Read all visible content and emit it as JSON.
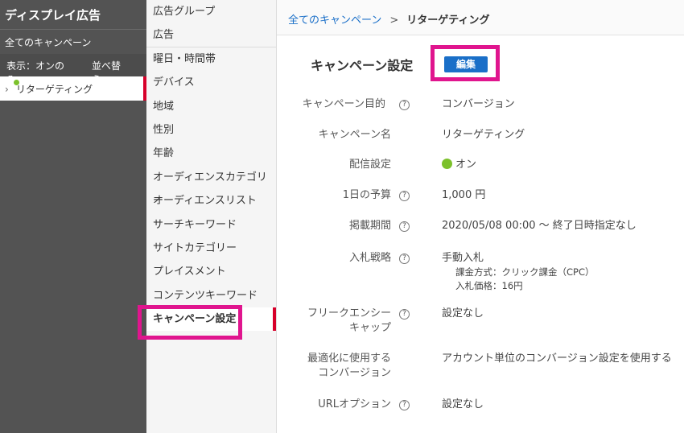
{
  "sidebar": {
    "title": "ディスプレイ広告",
    "all_campaigns": "全てのキャンペーン",
    "filter_label": "表示：オンのみ",
    "sort_label": "並べ替え",
    "campaign_name": "リターゲティング",
    "status_color": "#7cc12b"
  },
  "midnav": {
    "items": [
      {
        "label": "広告グループ"
      },
      {
        "label": "広告"
      },
      {
        "label": "曜日・時間帯"
      },
      {
        "label": "デバイス"
      },
      {
        "label": "地域"
      },
      {
        "label": "性別"
      },
      {
        "label": "年齢"
      },
      {
        "label": "オーディエンスカテゴリー"
      },
      {
        "label": "オーディエンスリスト"
      },
      {
        "label": "サーチキーワード"
      },
      {
        "label": "サイトカテゴリー"
      },
      {
        "label": "プレイスメント"
      },
      {
        "label": "コンテンツキーワード"
      },
      {
        "label": "キャンペーン設定"
      }
    ],
    "active_index": 13
  },
  "breadcrumb": {
    "root": "全てのキャンペーン",
    "separator": ">",
    "current": "リターゲティング"
  },
  "settings": {
    "heading": "キャンペーン設定",
    "edit_label": "編集",
    "rows": {
      "objective": {
        "label": "キャンペーン目的",
        "value": "コンバージョン"
      },
      "name": {
        "label": "キャンペーン名",
        "value": "リターゲティング"
      },
      "delivery": {
        "label": "配信設定",
        "value": "オン"
      },
      "budget": {
        "label": "1日の予算",
        "value": "1,000 円"
      },
      "period": {
        "label": "掲載期間",
        "value": "2020/05/08 00:00 ～ 終了日時指定なし"
      },
      "bidding": {
        "label": "入札戦略",
        "value": "手動入札",
        "billing": "課金方式：クリック課金（CPC）",
        "bid_price": "入札価格：16円"
      },
      "frequency": {
        "label_line1": "フリークエンシー",
        "label_line2": "キャップ",
        "value": "設定なし"
      },
      "conversion": {
        "label_line1": "最適化に使用する",
        "label_line2": "コンバージョン",
        "value": "アカウント単位のコンバージョン設定を使用する"
      },
      "url_option": {
        "label": "URLオプション",
        "value": "設定なし"
      }
    }
  },
  "colors": {
    "accent_blue": "#1a6fc8",
    "highlight_magenta": "#e0158e",
    "active_red": "#d7002a"
  }
}
